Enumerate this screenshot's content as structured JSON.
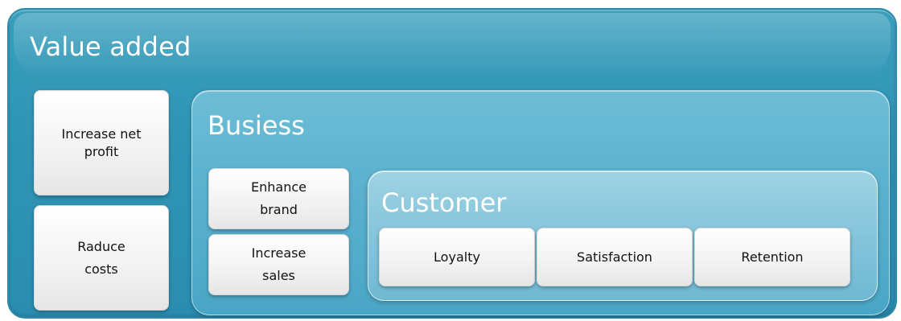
{
  "outer": {
    "title": "Value added",
    "left_boxes": [
      {
        "lines": [
          "Increase net",
          "profit"
        ]
      },
      {
        "lines": [
          "Raduce",
          "costs"
        ]
      }
    ]
  },
  "business": {
    "title": "Busiess",
    "boxes": [
      {
        "lines": [
          "Enhance",
          "brand"
        ]
      },
      {
        "lines": [
          "Increase",
          "sales"
        ]
      }
    ]
  },
  "customer": {
    "title": "Customer",
    "boxes": [
      {
        "label": "Loyalty"
      },
      {
        "label": "Satisfaction"
      },
      {
        "label": "Retention"
      }
    ]
  },
  "colors": {
    "outer_fill": "#2f94b4",
    "business_fill": "#5cb2cf",
    "customer_fill": "#87c6dc",
    "box_fill": "#f2f2f2",
    "title_text": "#ffffff"
  }
}
